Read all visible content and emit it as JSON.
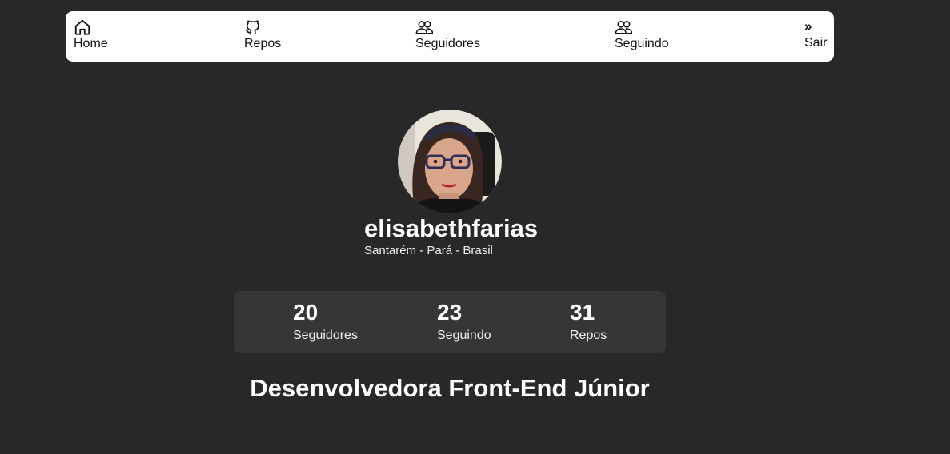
{
  "nav": {
    "home_label": "Home",
    "repos_label": "Repos",
    "followers_label": "Seguidores",
    "following_label": "Seguindo",
    "logout_label": "Sair",
    "logout_icon": "»"
  },
  "profile": {
    "username": "elisabethfarias",
    "location": "Santarém - Pará - Brasil",
    "bio": "Desenvolvedora Front-End Júnior"
  },
  "stats": {
    "followers_count": "20",
    "followers_label": "Seguidores",
    "following_count": "23",
    "following_label": "Seguindo",
    "repos_count": "31",
    "repos_label": "Repos"
  },
  "colors": {
    "background": "#282828",
    "nav_background": "#ffffff",
    "stats_background": "#363636",
    "text": "#ffffff"
  }
}
